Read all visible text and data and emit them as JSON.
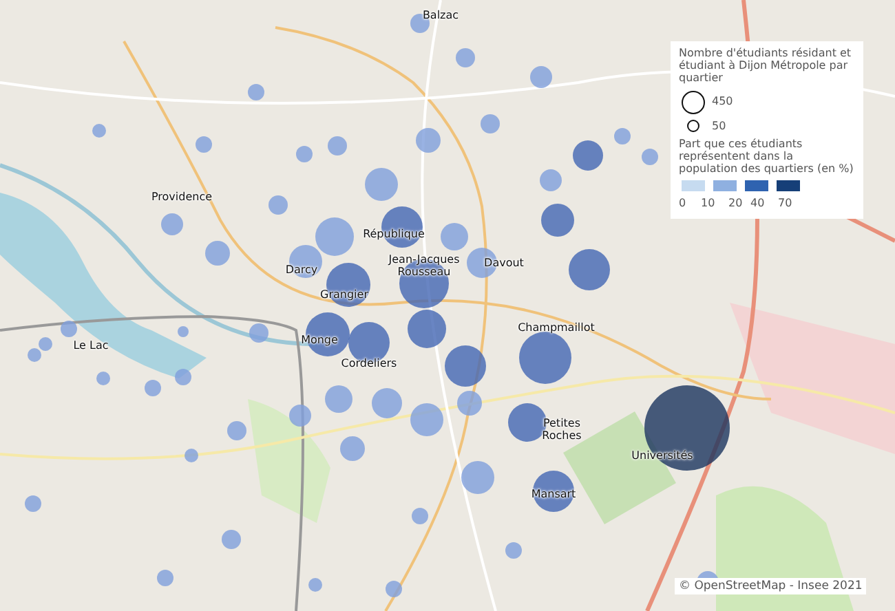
{
  "map": {
    "places": [
      {
        "label": "Balzac"
      },
      {
        "label": "Providence"
      },
      {
        "label": "République"
      },
      {
        "label": "Darcy"
      },
      {
        "label": "Jean-Jacques Rousseau"
      },
      {
        "label": "Davout"
      },
      {
        "label": "Grangier"
      },
      {
        "label": "Le Lac"
      },
      {
        "label": "Monge"
      },
      {
        "label": "Champmaillot"
      },
      {
        "label": "Cordeliers"
      },
      {
        "label": "Petites Roches"
      },
      {
        "label": "Universités"
      },
      {
        "label": "Mansart"
      }
    ]
  },
  "legend": {
    "size_title": "Nombre d'étudiants résidant et étudiant à Dijon Métropole par quartier",
    "size_items": [
      {
        "label": "450"
      },
      {
        "label": "50"
      }
    ],
    "color_title": "Part que ces étudiants représentent dans la population des quartiers (en %)",
    "color_classes": [
      {
        "color": "#c6dbf0"
      },
      {
        "color": "#8fb0e0"
      },
      {
        "color": "#2f63b0"
      },
      {
        "color": "#163f78"
      }
    ],
    "color_ticks": [
      "0",
      "10",
      "20",
      "40",
      "70"
    ]
  },
  "credit": "© OpenStreetMap - Insee 2021"
}
